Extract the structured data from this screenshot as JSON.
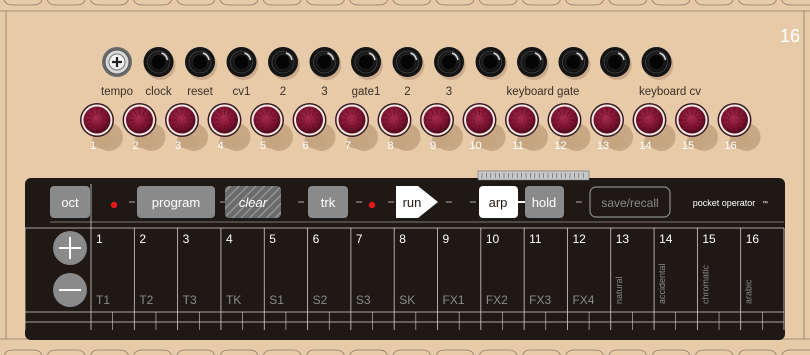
{
  "panel_number": "16",
  "jacks": [
    {
      "label": "tempo",
      "kind": "knob"
    },
    {
      "label": "clock"
    },
    {
      "label": "reset"
    },
    {
      "label": "cv1"
    },
    {
      "label": "2"
    },
    {
      "label": "3"
    },
    {
      "label": "gate1"
    },
    {
      "label": "2"
    },
    {
      "label": "3"
    },
    {
      "label": ""
    },
    {
      "label": ""
    },
    {
      "label": ""
    },
    {
      "label": ""
    },
    {
      "label": ""
    }
  ],
  "jack_group_labels": [
    "keyboard gate",
    "keyboard cv"
  ],
  "knob_numbers": [
    "1",
    "2",
    "3",
    "4",
    "5",
    "6",
    "7",
    "8",
    "9",
    "10",
    "11",
    "12",
    "13",
    "14",
    "15",
    "16"
  ],
  "buttons": {
    "oct": "oct",
    "program": "program",
    "clear": "clear",
    "trk": "trk",
    "run": "run",
    "arp": "arp",
    "hold": "hold",
    "save_recall": "save/recall",
    "brand": "pocket operator",
    "trademark": "™"
  },
  "columns": [
    {
      "num": "1",
      "label": "T1"
    },
    {
      "num": "2",
      "label": "T2"
    },
    {
      "num": "3",
      "label": "T3"
    },
    {
      "num": "4",
      "label": "TK"
    },
    {
      "num": "5",
      "label": "S1"
    },
    {
      "num": "6",
      "label": "S2"
    },
    {
      "num": "7",
      "label": "S3"
    },
    {
      "num": "8",
      "label": "SK"
    },
    {
      "num": "9",
      "label": "FX1"
    },
    {
      "num": "10",
      "label": "FX2"
    },
    {
      "num": "11",
      "label": "FX3"
    },
    {
      "num": "12",
      "label": "FX4"
    },
    {
      "num": "13",
      "label": "natural"
    },
    {
      "num": "14",
      "label": "accidental"
    },
    {
      "num": "15",
      "label": "chromatic"
    },
    {
      "num": "16",
      "label": "arabic"
    }
  ],
  "colors": {
    "panel": "#e7caa8",
    "panel_line": "#8a7868",
    "keyboard_bg": "#1f1915",
    "knob_red": "#861a36",
    "button_grey": "#8a8a8a",
    "led_red": "#e01818",
    "label_light": "#f2f2f2",
    "label_dim": "#8a8a8a"
  },
  "icons": {
    "plus": "plus-icon",
    "minus": "minus-icon",
    "run_arrow": "run-arrow-icon"
  }
}
